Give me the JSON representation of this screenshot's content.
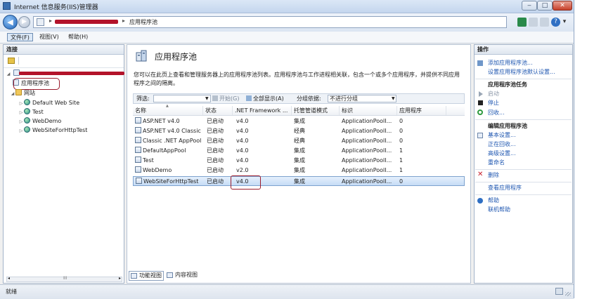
{
  "window": {
    "title": "Internet 信息服务(IIS)管理器",
    "controls": {
      "min": "‒",
      "max": "□",
      "close": "✕"
    }
  },
  "address": {
    "separator": "▸",
    "crumb": "应用程序池"
  },
  "toolbar_right": {
    "help": "?",
    "dropdown": "▾"
  },
  "menu": {
    "items": [
      "文件(F)",
      "视图(V)",
      "帮助(H)"
    ]
  },
  "connections": {
    "header": "连接",
    "tree": {
      "app_pools": "应用程序池",
      "sites": "网站",
      "site_list": [
        "Default Web Site",
        "Test",
        "WebDemo",
        "WebSiteForHttpTest"
      ]
    },
    "scroll": {
      "left": "◂",
      "grip": "III",
      "right": "▸"
    }
  },
  "main": {
    "title": "应用程序池",
    "description": "您可以在此页上查看和管理服务器上的应用程序池列表。应用程序池与工作进程相关联，包含一个或多个应用程序，并提供不同应用程序之间的隔离。",
    "filter": {
      "label": "筛选:",
      "start": "开始(G)",
      "show_all": "全部显示(A)",
      "group_label": "分组依据:",
      "group_value": "不进行分组",
      "sort_arrow": "▲"
    },
    "columns": [
      "名称",
      "状态",
      ".NET Framework ...",
      "托管管道模式",
      "标识",
      "应用程序"
    ],
    "rows": [
      {
        "name": "ASP.NET v4.0",
        "status": "已启动",
        "net": "v4.0",
        "mode": "集成",
        "identity": "ApplicationPoolI...",
        "apps": "0"
      },
      {
        "name": "ASP.NET v4.0 Classic",
        "status": "已启动",
        "net": "v4.0",
        "mode": "经典",
        "identity": "ApplicationPoolI...",
        "apps": "0"
      },
      {
        "name": "Classic .NET AppPool",
        "status": "已启动",
        "net": "v4.0",
        "mode": "经典",
        "identity": "ApplicationPoolI...",
        "apps": "0"
      },
      {
        "name": "DefaultAppPool",
        "status": "已启动",
        "net": "v4.0",
        "mode": "集成",
        "identity": "ApplicationPoolI...",
        "apps": "1"
      },
      {
        "name": "Test",
        "status": "已启动",
        "net": "v4.0",
        "mode": "集成",
        "identity": "ApplicationPoolI...",
        "apps": "1"
      },
      {
        "name": "WebDemo",
        "status": "已启动",
        "net": "v2.0",
        "mode": "集成",
        "identity": "ApplicationPoolI...",
        "apps": "1"
      },
      {
        "name": "WebSiteForHttpTest",
        "status": "已启动",
        "net": "v4.0",
        "mode": "集成",
        "identity": "ApplicationPoolI...",
        "apps": "0"
      }
    ],
    "view_tabs": [
      "功能视图",
      "内容视图"
    ]
  },
  "actions": {
    "header": "操作",
    "add_pool": "添加应用程序池...",
    "set_defaults": "设置应用程序池默认设置...",
    "tasks_header": "应用程序池任务",
    "start": "启动",
    "stop": "停止",
    "recycle": "回收...",
    "edit_header": "编辑应用程序池",
    "basic": "基本设置...",
    "recycling": "正在回收...",
    "advanced": "高级设置...",
    "rename": "重命名",
    "delete": "删除",
    "view_apps": "查看应用程序",
    "help": "帮助",
    "online_help": "联机帮助"
  },
  "status": {
    "text": "就绪"
  },
  "colors": {
    "accent": "#1e56b0",
    "highlight": "#9b1b2c",
    "redaction": "#b3132a"
  }
}
